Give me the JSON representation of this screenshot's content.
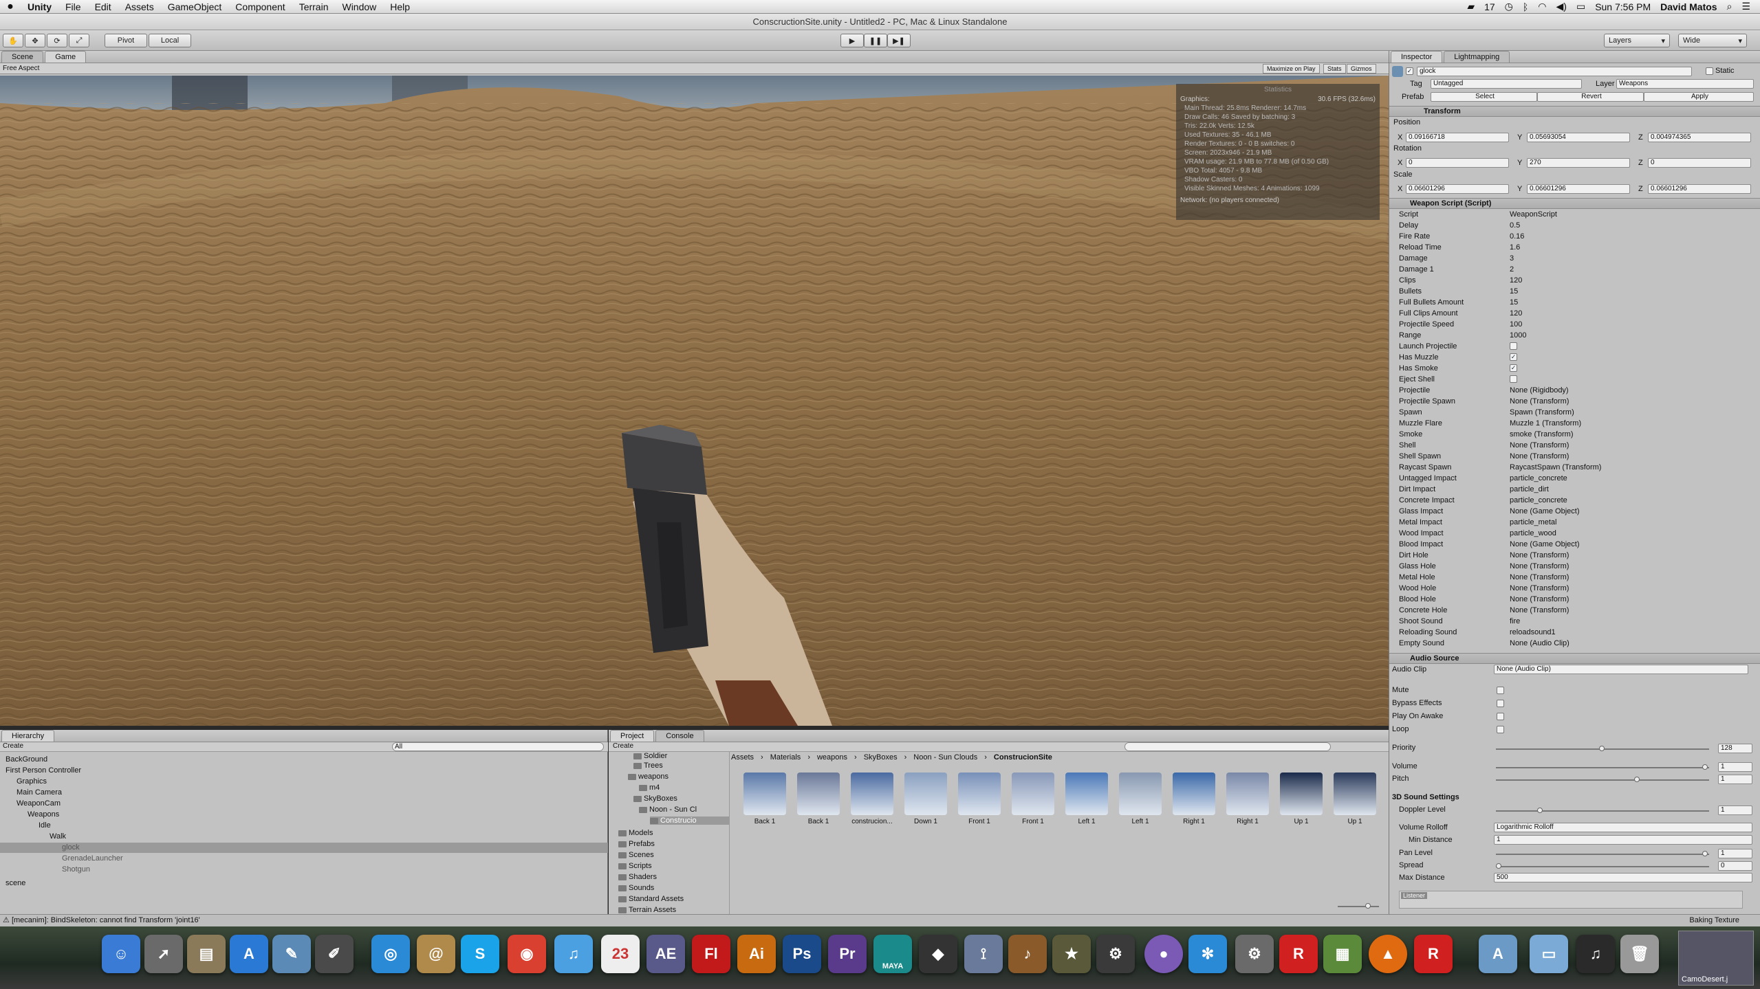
{
  "menubar": {
    "app": "Unity",
    "items": [
      "File",
      "Edit",
      "Assets",
      "GameObject",
      "Component",
      "Terrain",
      "Window",
      "Help"
    ],
    "status_count": "17",
    "clock": "Sun 7:56 PM",
    "user": "David Matos"
  },
  "window_title": "ConscructionSite.unity - Untitled2 - PC, Mac & Linux Standalone",
  "toolbar": {
    "pivot": "Pivot",
    "local": "Local",
    "layers": "Layers",
    "layout": "Wide"
  },
  "scene_tabs": {
    "scene": "Scene",
    "game": "Game"
  },
  "game_bar": {
    "aspect": "Free Aspect",
    "maximize": "Maximize on Play",
    "stats": "Stats",
    "gizmos": "Gizmos"
  },
  "stats": {
    "title": "Statistics",
    "graphics": "Graphics:",
    "fps": "30.6 FPS (32.6ms)",
    "lines": [
      "Main Thread: 25.8ms  Renderer: 14.7ms",
      "Draw Calls: 46   Saved by batching: 3",
      "Tris: 22.0k    Verts: 12.5k",
      "Used Textures: 35 - 46.1 MB",
      "Render Textures: 0 - 0 B  switches: 0",
      "Screen: 2023x946 - 21.9 MB",
      "VRAM usage: 21.9 MB to 77.8 MB (of 0.50 GB)",
      "VBO Total: 4057 - 9.8 MB",
      "Shadow Casters: 0",
      "Visible Skinned Meshes: 4     Animations: 1099"
    ],
    "network": "Network: (no players connected)"
  },
  "inspector": {
    "tabs": [
      "Inspector",
      "Lightmapping"
    ],
    "object_name": "glock",
    "static": "Static",
    "tag_label": "Tag",
    "tag_value": "Untagged",
    "layer_label": "Layer",
    "layer_value": "Weapons",
    "prefab_label": "Prefab",
    "prefab_buttons": [
      "Select",
      "Revert",
      "Apply"
    ],
    "transform": {
      "title": "Transform",
      "position_label": "Position",
      "position": [
        "0.09166718",
        "0.05693054",
        "0.004974365"
      ],
      "rotation_label": "Rotation",
      "rotation": [
        "0",
        "270",
        "0"
      ],
      "scale_label": "Scale",
      "scale": [
        "0.06601296",
        "0.06601296",
        "0.06601296"
      ]
    },
    "weapon_script": {
      "title": "Weapon Script (Script)",
      "fields": [
        {
          "label": "Script",
          "value": "WeaponScript"
        },
        {
          "label": "Delay",
          "value": "0.5"
        },
        {
          "label": "Fire Rate",
          "value": "0.16"
        },
        {
          "label": "Reload Time",
          "value": "1.6"
        },
        {
          "label": "Damage",
          "value": "3"
        },
        {
          "label": "Damage 1",
          "value": "2"
        },
        {
          "label": "Clips",
          "value": "120"
        },
        {
          "label": "Bullets",
          "value": "15"
        },
        {
          "label": "Full Bullets Amount",
          "value": "15"
        },
        {
          "label": "Full Clips Amount",
          "value": "120"
        },
        {
          "label": "Projectile Speed",
          "value": "100"
        },
        {
          "label": "Range",
          "value": "1000"
        },
        {
          "label": "Launch Projectile",
          "value": ""
        },
        {
          "label": "Has Muzzle",
          "value": "✓"
        },
        {
          "label": "Has Smoke",
          "value": "✓"
        },
        {
          "label": "Eject Shell",
          "value": ""
        },
        {
          "label": "Projectile",
          "value": "None (Rigidbody)"
        },
        {
          "label": "Projectile Spawn",
          "value": "None (Transform)"
        },
        {
          "label": "Spawn",
          "value": "Spawn (Transform)"
        },
        {
          "label": "Muzzle Flare",
          "value": "Muzzle 1 (Transform)"
        },
        {
          "label": "Smoke",
          "value": "smoke (Transform)"
        },
        {
          "label": "Shell",
          "value": "None (Transform)"
        },
        {
          "label": "Shell Spawn",
          "value": "None (Transform)"
        },
        {
          "label": "Raycast Spawn",
          "value": "RaycastSpawn (Transform)"
        },
        {
          "label": "Untagged Impact",
          "value": "particle_concrete"
        },
        {
          "label": "Dirt Impact",
          "value": "particle_dirt"
        },
        {
          "label": "Concrete Impact",
          "value": "particle_concrete"
        },
        {
          "label": "Glass Impact",
          "value": "None (Game Object)"
        },
        {
          "label": "Metal Impact",
          "value": "particle_metal"
        },
        {
          "label": "Wood Impact",
          "value": "particle_wood"
        },
        {
          "label": "Blood Impact",
          "value": "None (Game Object)"
        },
        {
          "label": "Dirt Hole",
          "value": "None (Transform)"
        },
        {
          "label": "Glass Hole",
          "value": "None (Transform)"
        },
        {
          "label": "Metal Hole",
          "value": "None (Transform)"
        },
        {
          "label": "Wood Hole",
          "value": "None (Transform)"
        },
        {
          "label": "Blood Hole",
          "value": "None (Transform)"
        },
        {
          "label": "Concrete Hole",
          "value": "None (Transform)"
        },
        {
          "label": "Shoot Sound",
          "value": "fire"
        },
        {
          "label": "Reloading Sound",
          "value": "reloadsound1"
        },
        {
          "label": "Empty Sound",
          "value": "None (Audio Clip)"
        }
      ]
    },
    "audio_source": {
      "title": "Audio Source",
      "audio_clip_label": "Audio Clip",
      "audio_clip": "None (Audio Clip)",
      "mute": "Mute",
      "bypass": "Bypass Effects",
      "play_on_awake": "Play On Awake",
      "loop": "Loop",
      "priority_label": "Priority",
      "priority": "128",
      "priority_level": 0.5,
      "volume_label": "Volume",
      "volume": "1",
      "volume_level": 1.0,
      "pitch_label": "Pitch",
      "pitch": "1",
      "pitch_level": 0.67,
      "settings_3d": "3D Sound Settings",
      "doppler_label": "Doppler Level",
      "doppler": "1",
      "doppler_level": 0.2,
      "rolloff_label": "Volume Rolloff",
      "rolloff": "Logarithmic Rolloff",
      "min_distance_label": "Min Distance",
      "min_distance": "1",
      "pan_label": "Pan Level",
      "pan": "1",
      "pan_level": 1.0,
      "spread_label": "Spread",
      "spread": "0",
      "spread_level": 0.0,
      "max_distance_label": "Max Distance",
      "max_distance": "500",
      "listener": "Listener"
    }
  },
  "hierarchy": {
    "title": "Hierarchy",
    "create": "Create",
    "search_placeholder": "All",
    "items": [
      "BackGround",
      "First Person Controller",
      "Graphics",
      "Main Camera",
      "WeaponCam",
      "Weapons",
      "Idle",
      "Walk",
      "glock",
      "GrenadeLauncher",
      "Shotgun",
      "scene"
    ]
  },
  "project": {
    "tabs": [
      "Project",
      "Console"
    ],
    "create": "Create",
    "tree": [
      "Soldier",
      "Trees",
      "weapons",
      "m4",
      "SkyBoxes",
      "Noon - Sun Cl",
      "Construcio",
      "Models",
      "Prefabs",
      "Scenes",
      "Scripts",
      "Shaders",
      "Sounds",
      "Standard Assets",
      "Terrain Assets"
    ],
    "breadcrumb": [
      "Assets",
      "Materials",
      "weapons",
      "SkyBoxes",
      "Noon - Sun Clouds",
      "ConstrucionSite"
    ],
    "assets": [
      "Back 1",
      "Back 1",
      "construcion...",
      "Down 1",
      "Front 1",
      "Front 1",
      "Left 1",
      "Left 1",
      "Right 1",
      "Right 1",
      "Up 1",
      "Up 1"
    ]
  },
  "status": {
    "message": "[mecanim]: BindSkeleton: cannot find Transform 'joint16'",
    "baking": "Baking Texture"
  },
  "dock": {
    "calendar_day": "23",
    "labels": [
      "AE",
      "Fl",
      "Ai",
      "Ps",
      "Pr",
      "MAYA",
      "R",
      "R"
    ],
    "desktop_label": "CamoDesert.j"
  }
}
